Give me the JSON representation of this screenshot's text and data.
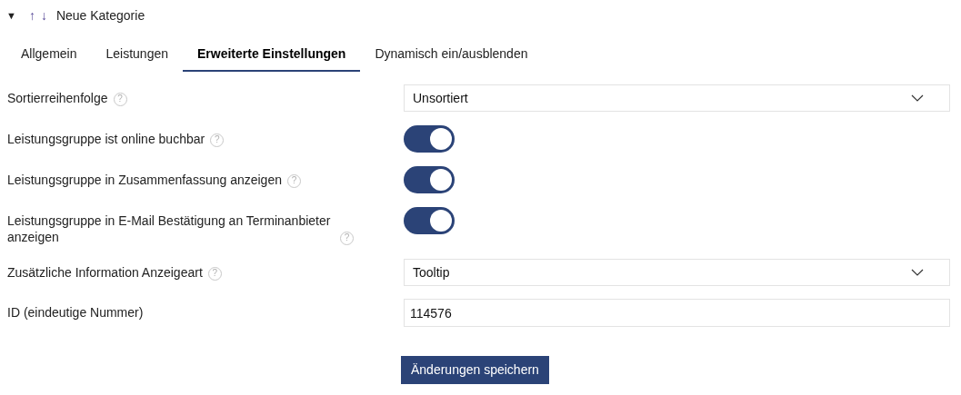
{
  "header": {
    "expand_glyph": "▼",
    "up_glyph": "↑",
    "down_glyph": "↓",
    "title": "Neue Kategorie"
  },
  "tabs": [
    {
      "label": "Allgemein",
      "selected": false
    },
    {
      "label": "Leistungen",
      "selected": false
    },
    {
      "label": "Erweiterte Einstellungen",
      "selected": true
    },
    {
      "label": "Dynamisch ein/ausblenden",
      "selected": false
    }
  ],
  "settings": [
    {
      "kind": "select",
      "label": "Sortierreihenfolge",
      "help": "?",
      "value": "Unsortiert"
    },
    {
      "kind": "toggle",
      "label": "Leistungsgruppe ist online buchbar",
      "help": "?",
      "on": true
    },
    {
      "kind": "toggle",
      "label": "Leistungsgruppe in Zusammenfassung anzeigen",
      "help": "?",
      "on": true
    },
    {
      "kind": "toggle",
      "label": "Leistungsgruppe in E-Mail Bestätigung an Terminanbieter anzeigen",
      "help": "?",
      "on": true
    },
    {
      "kind": "select",
      "label": "Zusätzliche Information Anzeigeart",
      "help": "?",
      "value": "Tooltip"
    },
    {
      "kind": "text",
      "label": "ID (eindeutige Nummer)",
      "value": "114576"
    }
  ],
  "save_button": "Änderungen speichern"
}
